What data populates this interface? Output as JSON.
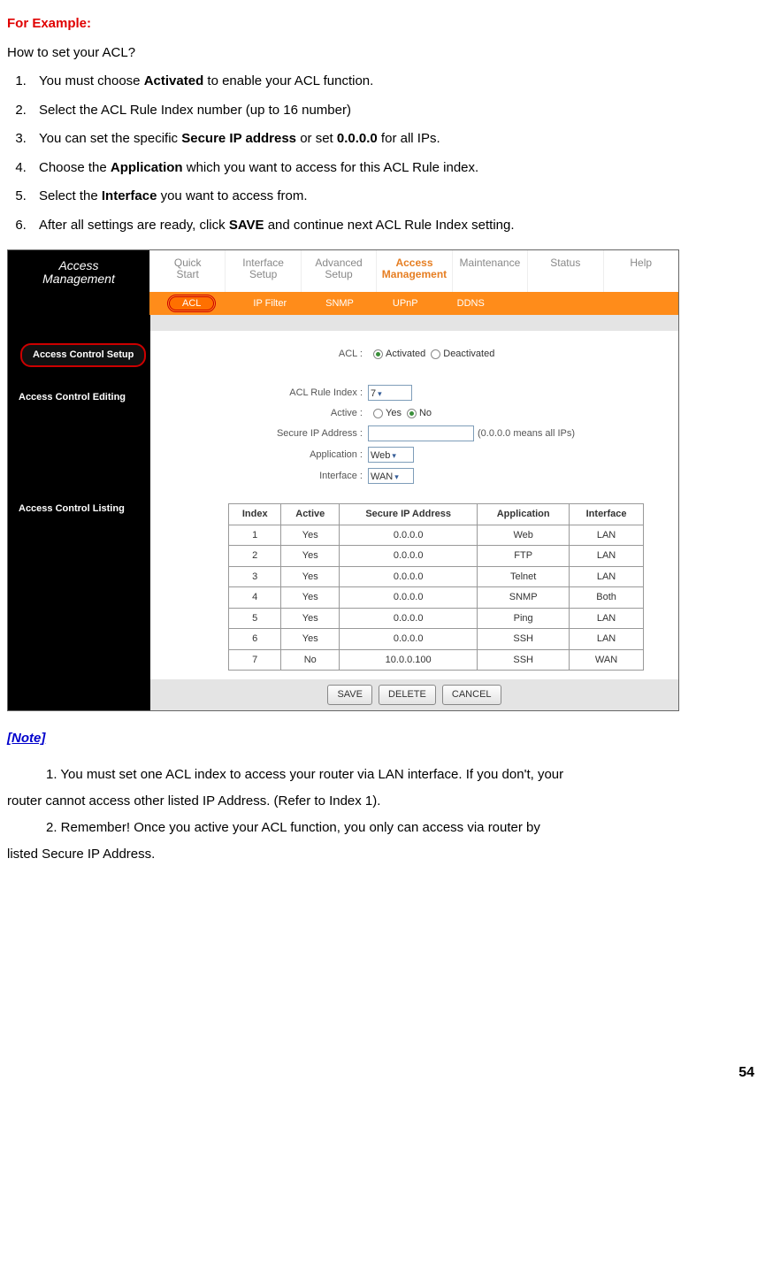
{
  "intro": {
    "for_example": "For Example:",
    "question": "How to set your ACL?",
    "steps": [
      {
        "pre": "You must choose ",
        "bold": "Activated",
        "post": " to enable your ACL function."
      },
      {
        "pre": "Select the ACL Rule Index number (up to 16 number)",
        "bold": "",
        "post": ""
      },
      {
        "pre": "You can set the specific ",
        "bold": "Secure IP address",
        "mid": " or set ",
        "bold2": "0.0.0.0",
        "post": " for all IPs."
      },
      {
        "pre": "Choose the ",
        "bold": "Application",
        "post": " which you want to access for this ACL Rule index."
      },
      {
        "pre": "Select the ",
        "bold": "Interface",
        "post": " you want to access from."
      },
      {
        "pre": "After all settings are ready, click ",
        "bold": "SAVE",
        "post": " and continue next ACL Rule Index setting."
      }
    ]
  },
  "router": {
    "brand1": "Access",
    "brand2": "Management",
    "tabs": [
      "Quick Start",
      "Interface Setup",
      "Advanced Setup",
      "Access Management",
      "Maintenance",
      "Status",
      "Help"
    ],
    "active_tab": 3,
    "subtabs": [
      "ACL",
      "IP Filter",
      "SNMP",
      "UPnP",
      "DDNS"
    ],
    "active_subtab": 0,
    "side": {
      "setup_chip": "Access Control Setup",
      "editing": "Access Control Editing",
      "listing": "Access Control Listing"
    },
    "form": {
      "acl_label": "ACL :",
      "activated": "Activated",
      "deactivated": "Deactivated",
      "rule_index_label": "ACL Rule Index :",
      "rule_index_value": "7",
      "active_label": "Active :",
      "yes": "Yes",
      "no": "No",
      "secure_ip_label": "Secure IP Address :",
      "secure_ip_value": "",
      "secure_ip_hint": "(0.0.0.0 means all IPs)",
      "application_label": "Application :",
      "application_value": "Web",
      "interface_label": "Interface :",
      "interface_value": "WAN"
    },
    "table": {
      "headers": [
        "Index",
        "Active",
        "Secure IP Address",
        "Application",
        "Interface"
      ],
      "rows": [
        [
          "1",
          "Yes",
          "0.0.0.0",
          "Web",
          "LAN"
        ],
        [
          "2",
          "Yes",
          "0.0.0.0",
          "FTP",
          "LAN"
        ],
        [
          "3",
          "Yes",
          "0.0.0.0",
          "Telnet",
          "LAN"
        ],
        [
          "4",
          "Yes",
          "0.0.0.0",
          "SNMP",
          "Both"
        ],
        [
          "5",
          "Yes",
          "0.0.0.0",
          "Ping",
          "LAN"
        ],
        [
          "6",
          "Yes",
          "0.0.0.0",
          "SSH",
          "LAN"
        ],
        [
          "7",
          "No",
          "10.0.0.100",
          "SSH",
          "WAN"
        ]
      ]
    },
    "buttons": {
      "save": "SAVE",
      "delete": "DELETE",
      "cancel": "CANCEL"
    }
  },
  "note": {
    "heading": "[Note]",
    "line1a": "1. You must set one ACL index to access your router via LAN interface. If you don't, your",
    "line1b": "router cannot access other listed IP Address. (Refer to Index 1).",
    "line2a": "2. Remember! Once you active your ACL function, you only can access via router by",
    "line2b": "listed Secure IP Address."
  },
  "page_number": "54"
}
